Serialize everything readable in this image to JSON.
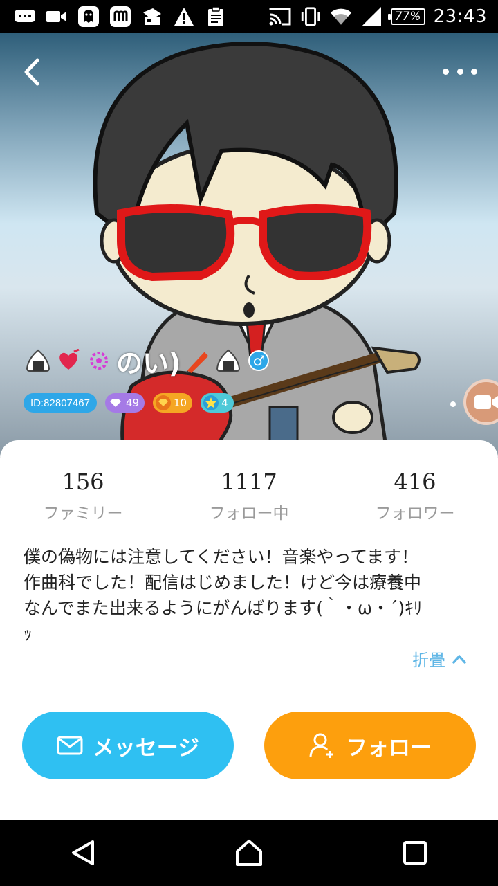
{
  "status_bar": {
    "battery": "77%",
    "time": "23:43",
    "icons": [
      "message-icon",
      "video-icon",
      "ghost-app-icon",
      "m-app-icon",
      "screenshot-icon",
      "warning-icon",
      "clipboard-icon",
      "cast-icon",
      "vibrate-icon",
      "wifi-icon",
      "signal-icon"
    ]
  },
  "profile": {
    "username": "のい)",
    "id_badge": "ID:82807467",
    "gem_count": "49",
    "gold_count": "10",
    "star_count": "4",
    "gender_symbol": "♂"
  },
  "stats": [
    {
      "value": "156",
      "label": "ファミリー"
    },
    {
      "value": "1117",
      "label": "フォロー中"
    },
    {
      "value": "416",
      "label": "フォロワー"
    }
  ],
  "bio": {
    "lines": [
      "僕の偽物には注意してください！音楽やってます！",
      "作曲科でした！配信はじめました！けど今は療養中",
      "なんでまた出来るようにがんばります(｀・ω・´)ｷﾘ",
      "ｯ"
    ],
    "collapse_label": "折畳"
  },
  "actions": {
    "message_label": "メッセージ",
    "follow_label": "フォロー"
  },
  "colors": {
    "accent_blue": "#2fc0f2",
    "accent_orange": "#fd9f0d",
    "link_blue": "#5fb6e6"
  }
}
